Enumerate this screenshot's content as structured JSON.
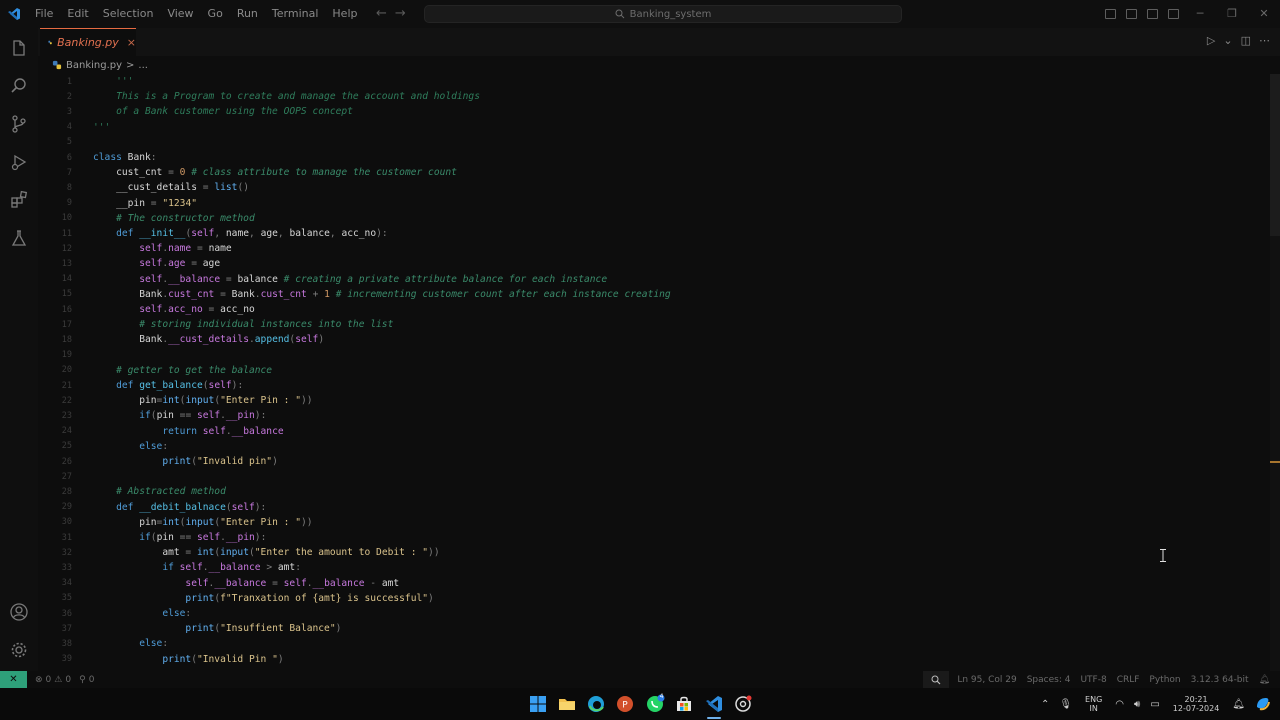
{
  "window": {
    "title": "Banking_system",
    "menu": [
      "File",
      "Edit",
      "Selection",
      "View",
      "Go",
      "Run",
      "Terminal",
      "Help"
    ]
  },
  "tab": {
    "file_name": "Banking.py",
    "close": "×"
  },
  "breadcrumb": {
    "file": "Banking.py",
    "separator": ">",
    "rest": "..."
  },
  "code_lines": [
    "    '''",
    "    This is a Program to create and manage the account and holdings",
    "    of a Bank customer using the OOPS concept",
    "'''",
    "",
    "class Bank:",
    "    cust_cnt = 0 # class attribute to manage the customer count",
    "    __cust_details = list()",
    "    __pin = \"1234\"",
    "    # The constructor method",
    "    def __init__(self, name, age, balance, acc_no):",
    "        self.name = name",
    "        self.age = age",
    "        self.__balance = balance # creating a private attribute balance for each instance",
    "        Bank.cust_cnt = Bank.cust_cnt + 1 # incrementing customer count after each instance creating",
    "        self.acc_no = acc_no",
    "        # storing individual instances into the list",
    "        Bank.__cust_details.append(self)",
    "",
    "    # getter to get the balance",
    "    def get_balance(self):",
    "        pin=int(input(\"Enter Pin : \"))",
    "        if(pin == self.__pin):",
    "            return self.__balance",
    "        else:",
    "            print(\"Invalid pin\")",
    "",
    "    # Abstracted method",
    "    def __debit_balnace(self):",
    "        pin=int(input(\"Enter Pin : \"))",
    "        if(pin == self.__pin):",
    "            amt = int(input(\"Enter the amount to Debit : \"))",
    "            if self.__balance > amt:",
    "                self.__balance = self.__balance - amt",
    "                print(f\"Tranxation of {amt} is successful\")",
    "            else:",
    "                print(\"Insuffient Balance\")",
    "        else:",
    "            print(\"Invalid Pin \")"
  ],
  "line_numbers": [
    "1",
    "2",
    "3",
    "4",
    "5",
    "6",
    "7",
    "8",
    "9",
    "10",
    "11",
    "12",
    "13",
    "14",
    "15",
    "16",
    "17",
    "18",
    "19",
    "20",
    "21",
    "22",
    "23",
    "24",
    "25",
    "26",
    "27",
    "28",
    "29",
    "30",
    "31",
    "32",
    "33",
    "34",
    "35",
    "36",
    "37",
    "38",
    "39"
  ],
  "status": {
    "errors": "0",
    "warnings": "0",
    "ports": "0",
    "position": "Ln 95, Col 29",
    "spaces": "Spaces: 4",
    "encoding": "UTF-8",
    "eol": "CRLF",
    "language": "Python",
    "interpreter": "3.12.3 64-bit"
  },
  "taskbar": {
    "lang_top": "ENG",
    "lang_bottom": "IN",
    "time": "20:21",
    "date": "12-07-2024",
    "whatsapp_badge": "4"
  },
  "colors": {
    "accent_tab": "#e66b42",
    "remote_green": "#2ea07a",
    "keyword": "#4f9bd6",
    "comment": "#3a8a6a",
    "string": "#d9c28b"
  }
}
